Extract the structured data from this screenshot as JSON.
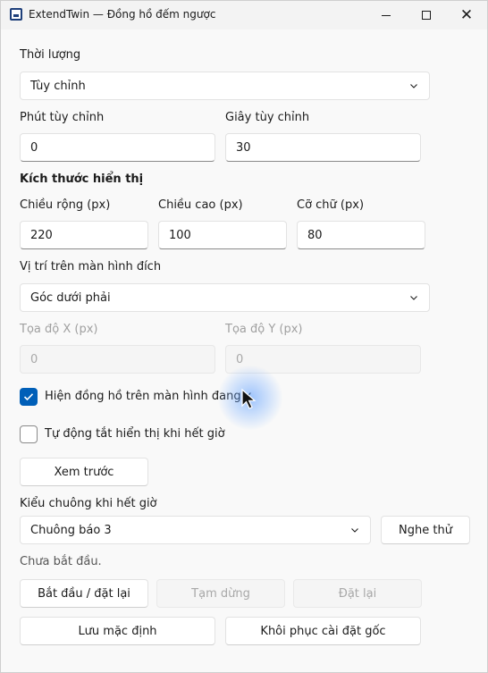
{
  "window": {
    "title": "ExtendTwin — Đồng hồ đếm ngược",
    "controls": {
      "minimize": "minimize-icon",
      "maximize": "maximize-icon",
      "close": "close-icon"
    }
  },
  "duration": {
    "label": "Thời lượng",
    "selected": "Tùy chỉnh",
    "custom_minutes_label": "Phút tùy chỉnh",
    "custom_minutes_value": "0",
    "custom_seconds_label": "Giây tùy chỉnh",
    "custom_seconds_value": "30"
  },
  "display_size": {
    "heading": "Kích thước hiển thị",
    "width_label": "Chiều rộng (px)",
    "width_value": "220",
    "height_label": "Chiều cao (px)",
    "height_value": "100",
    "font_size_label": "Cỡ chữ (px)",
    "font_size_value": "80"
  },
  "position": {
    "label": "Vị trí trên màn hình đích",
    "selected": "Góc dưới phải",
    "x_label": "Tọa độ X (px)",
    "x_value": "0",
    "y_label": "Tọa độ Y (px)",
    "y_value": "0"
  },
  "options": {
    "show_on_screen_label": "Hiện đồng hồ trên màn hình đang x",
    "show_on_screen_checked": true,
    "auto_hide_label": "Tự động tắt hiển thị khi hết giờ",
    "auto_hide_checked": false
  },
  "preview_button": "Xem trước",
  "bell": {
    "label": "Kiểu chuông khi hết giờ",
    "selected": "Chuông báo 3",
    "test_button": "Nghe thử"
  },
  "status": "Chưa bắt đầu.",
  "actions": {
    "start_reset": "Bắt đầu / đặt lại",
    "pause": "Tạm dừng",
    "reset": "Đặt lại",
    "save_default": "Lưu mặc định",
    "restore_factory": "Khôi phục cài đặt gốc"
  },
  "colors": {
    "accent": "#005fb8",
    "background": "#f9f9f9",
    "disabled_text": "#a8a8a8"
  }
}
